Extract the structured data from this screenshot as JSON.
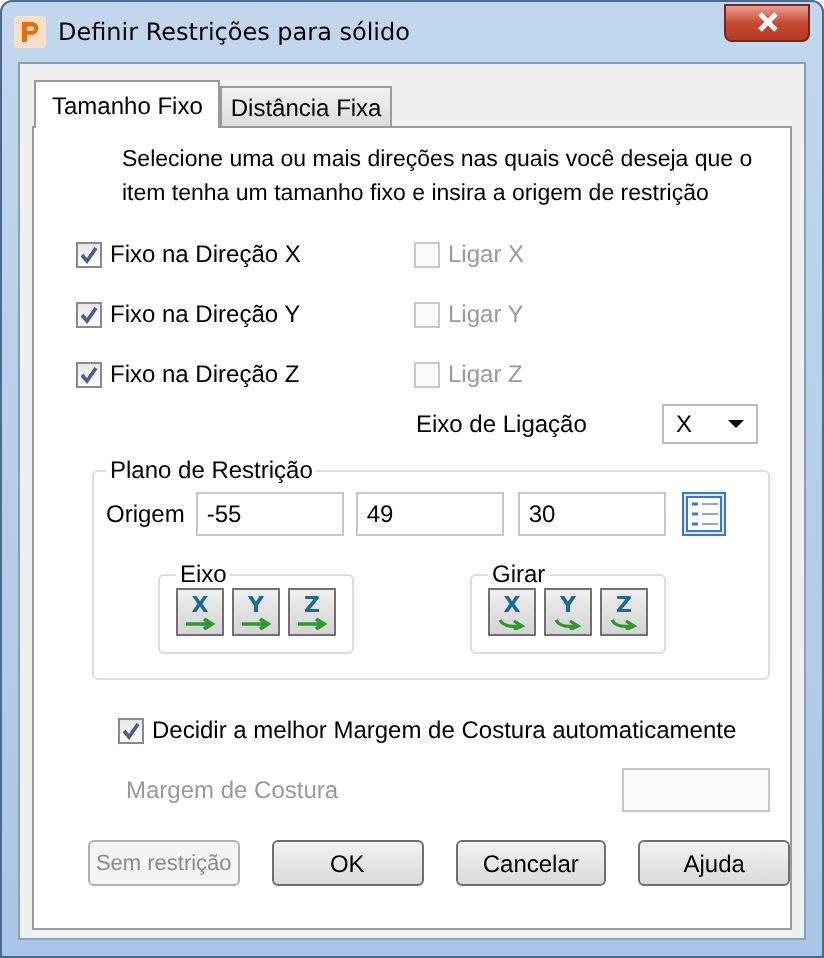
{
  "window": {
    "title": "Definir Restrições para sólido"
  },
  "tabs": [
    {
      "label": "Tamanho Fixo",
      "selected": true
    },
    {
      "label": "Distância Fixa",
      "selected": false
    }
  ],
  "instructions": "Selecione uma ou mais direções nas quais você deseja que o item tenha um tamanho fixo e insira a origem de restrição",
  "direction_rows": [
    {
      "fixed": {
        "label": "Fixo na Direção X",
        "checked": true
      },
      "link": {
        "label": "Ligar X",
        "checked": false,
        "disabled": true
      }
    },
    {
      "fixed": {
        "label": "Fixo na Direção Y",
        "checked": true
      },
      "link": {
        "label": "Ligar Y",
        "checked": false,
        "disabled": true
      }
    },
    {
      "fixed": {
        "label": "Fixo na Direção Z",
        "checked": true
      },
      "link": {
        "label": "Ligar Z",
        "checked": false,
        "disabled": true
      }
    }
  ],
  "link_axis": {
    "label": "Eixo de Ligação",
    "value": "X"
  },
  "constraint_plane": {
    "title": "Plano de Restrição",
    "origin_label": "Origem",
    "origin": [
      "-55",
      "49",
      "30"
    ],
    "groups": [
      {
        "title": "Eixo",
        "kind": "move",
        "buttons": [
          "X",
          "Y",
          "Z"
        ]
      },
      {
        "title": "Girar",
        "kind": "rotate",
        "buttons": [
          "X",
          "Y",
          "Z"
        ]
      }
    ]
  },
  "auto_margin": {
    "label": "Decidir a melhor Margem de Costura automaticamente",
    "checked": true
  },
  "margin": {
    "label": "Margem de Costura",
    "disabled": true
  },
  "buttons": [
    {
      "label": "Sem restrição",
      "disabled": true
    },
    {
      "label": "OK",
      "disabled": false
    },
    {
      "label": "Cancelar",
      "disabled": false
    },
    {
      "label": "Ajuda",
      "disabled": false
    }
  ]
}
